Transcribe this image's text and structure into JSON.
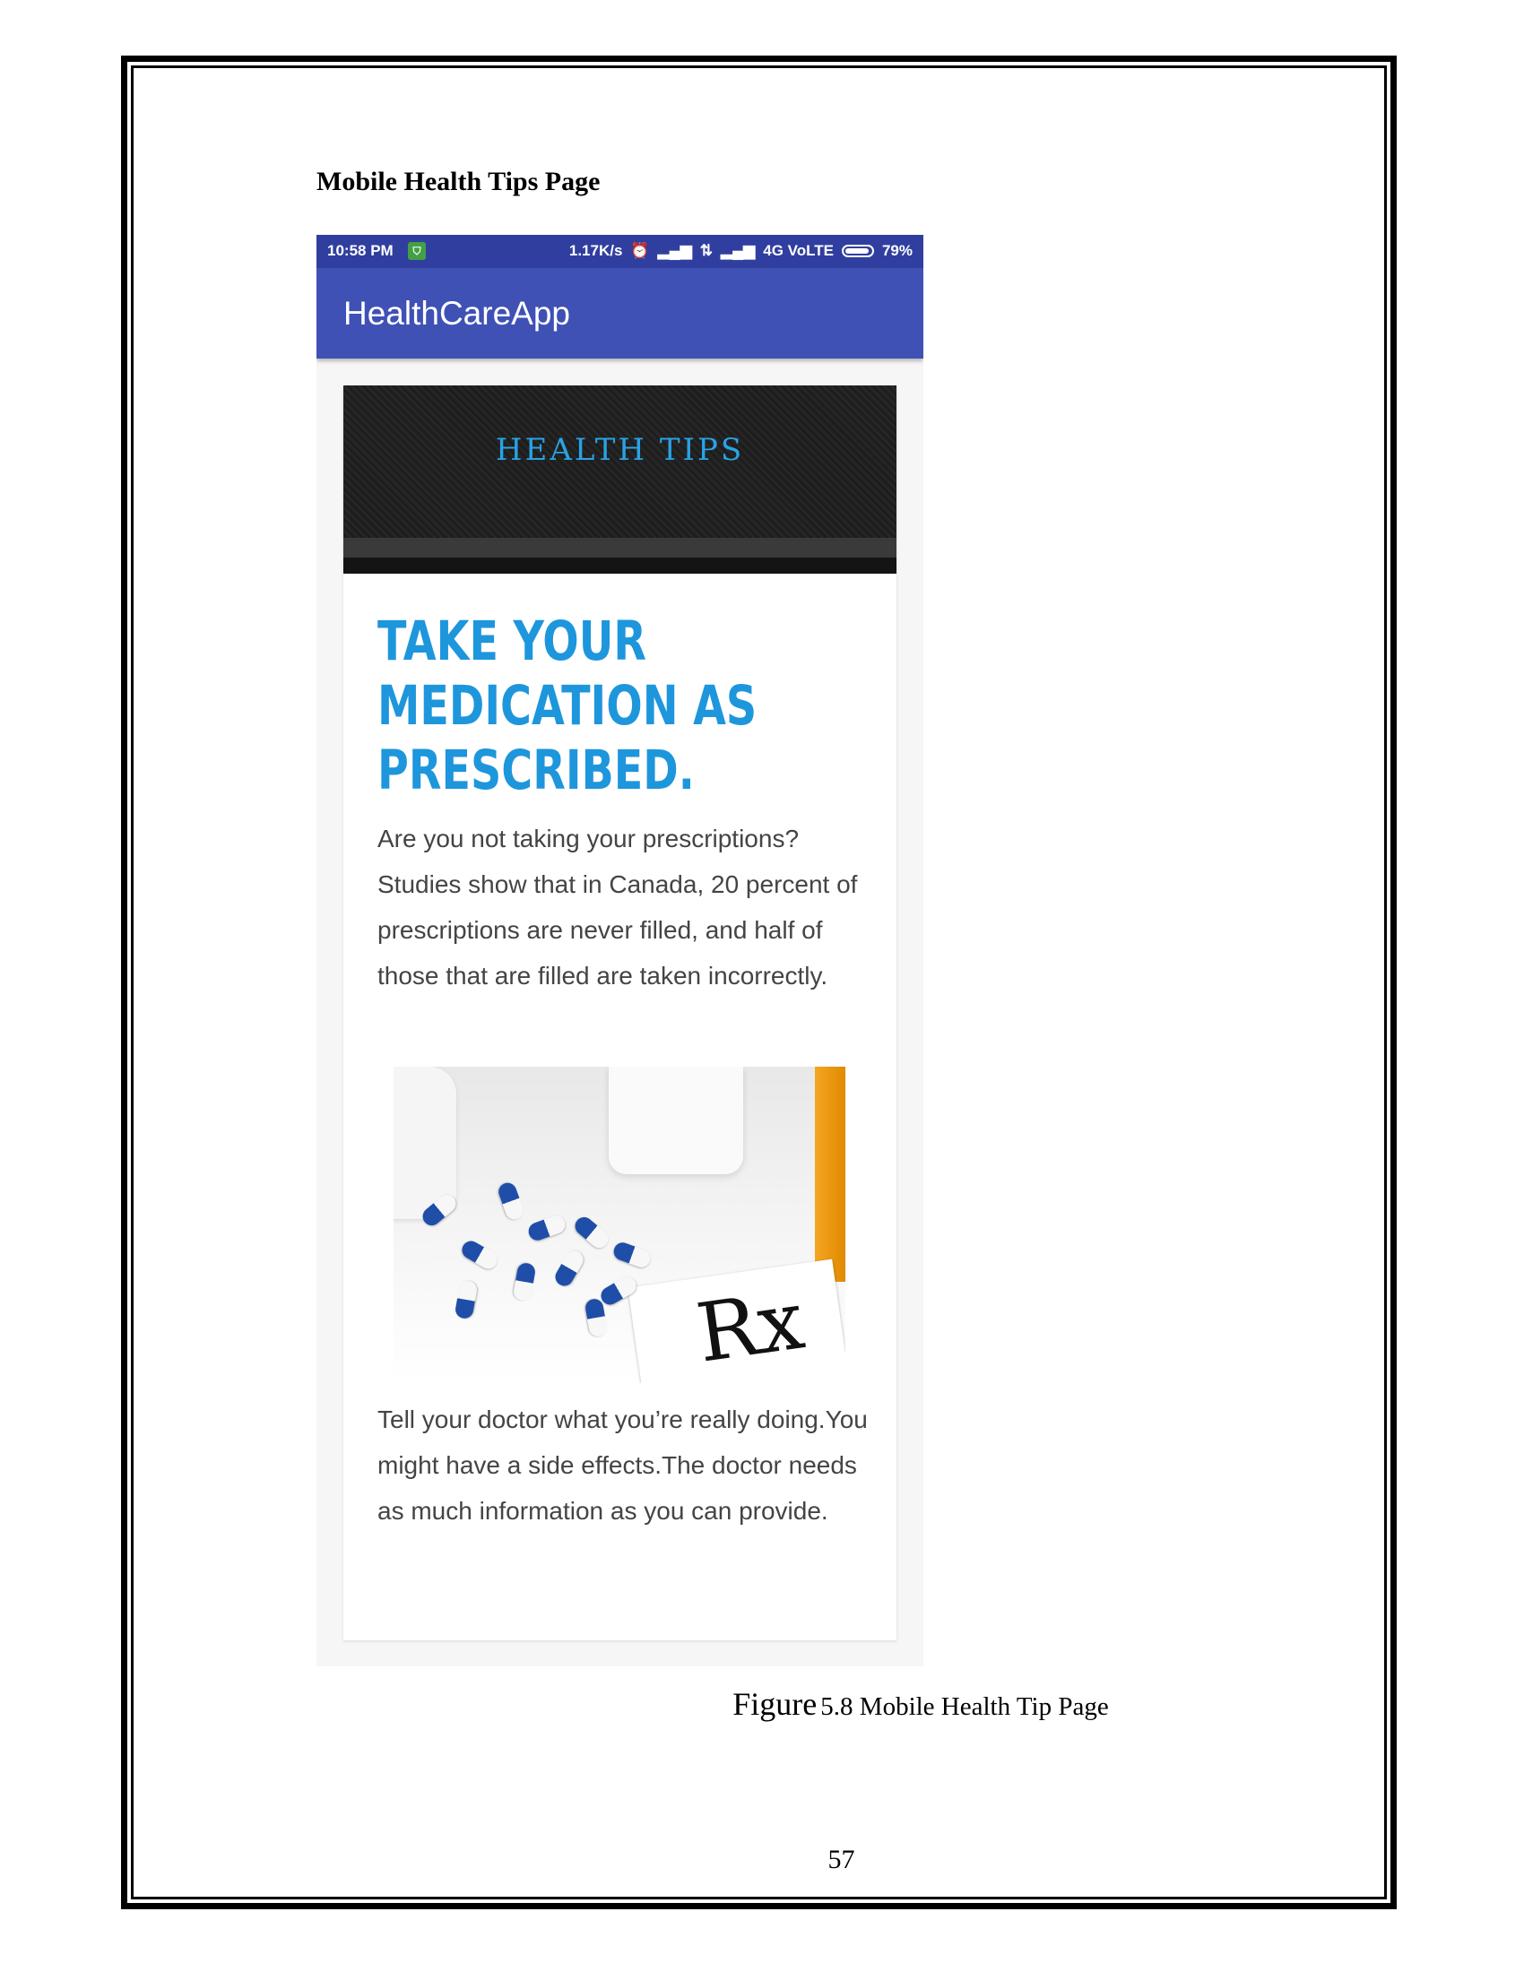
{
  "section_title": "Mobile Health Tips Page",
  "phone": {
    "status_bar": {
      "time": "10:58 PM",
      "speed": "1.17K/s",
      "network": "4G VoLTE",
      "battery": "79%",
      "icons": [
        "shield-icon",
        "alarm-icon",
        "signal-icon",
        "data-arrows-icon",
        "signal-icon",
        "battery-icon"
      ]
    },
    "app_title": "HealthCareApp",
    "banner_text": "HEALTH TIPS",
    "headline": [
      "TAKE YOUR",
      "MEDICATION AS",
      "PRESCRIBED."
    ],
    "paragraph1": "Are you not taking your prescriptions? Studies show that in Canada, 20 percent of prescriptions are never filled, and half of those that are filled are taken incorrectly.",
    "image_text": "Rx",
    "paragraph2": "Tell your doctor what you’re really doing.You might have a side effects.The doctor needs as much information as you can provide.",
    "colors": {
      "status_bar": "#303f9f",
      "app_bar": "#3f51b5",
      "headline": "#1e96dc",
      "banner_text": "#29a3e6"
    }
  },
  "caption": {
    "figure_word": "Figure",
    "rest": "5.8 Mobile Health Tip Page"
  },
  "page_number": "57"
}
